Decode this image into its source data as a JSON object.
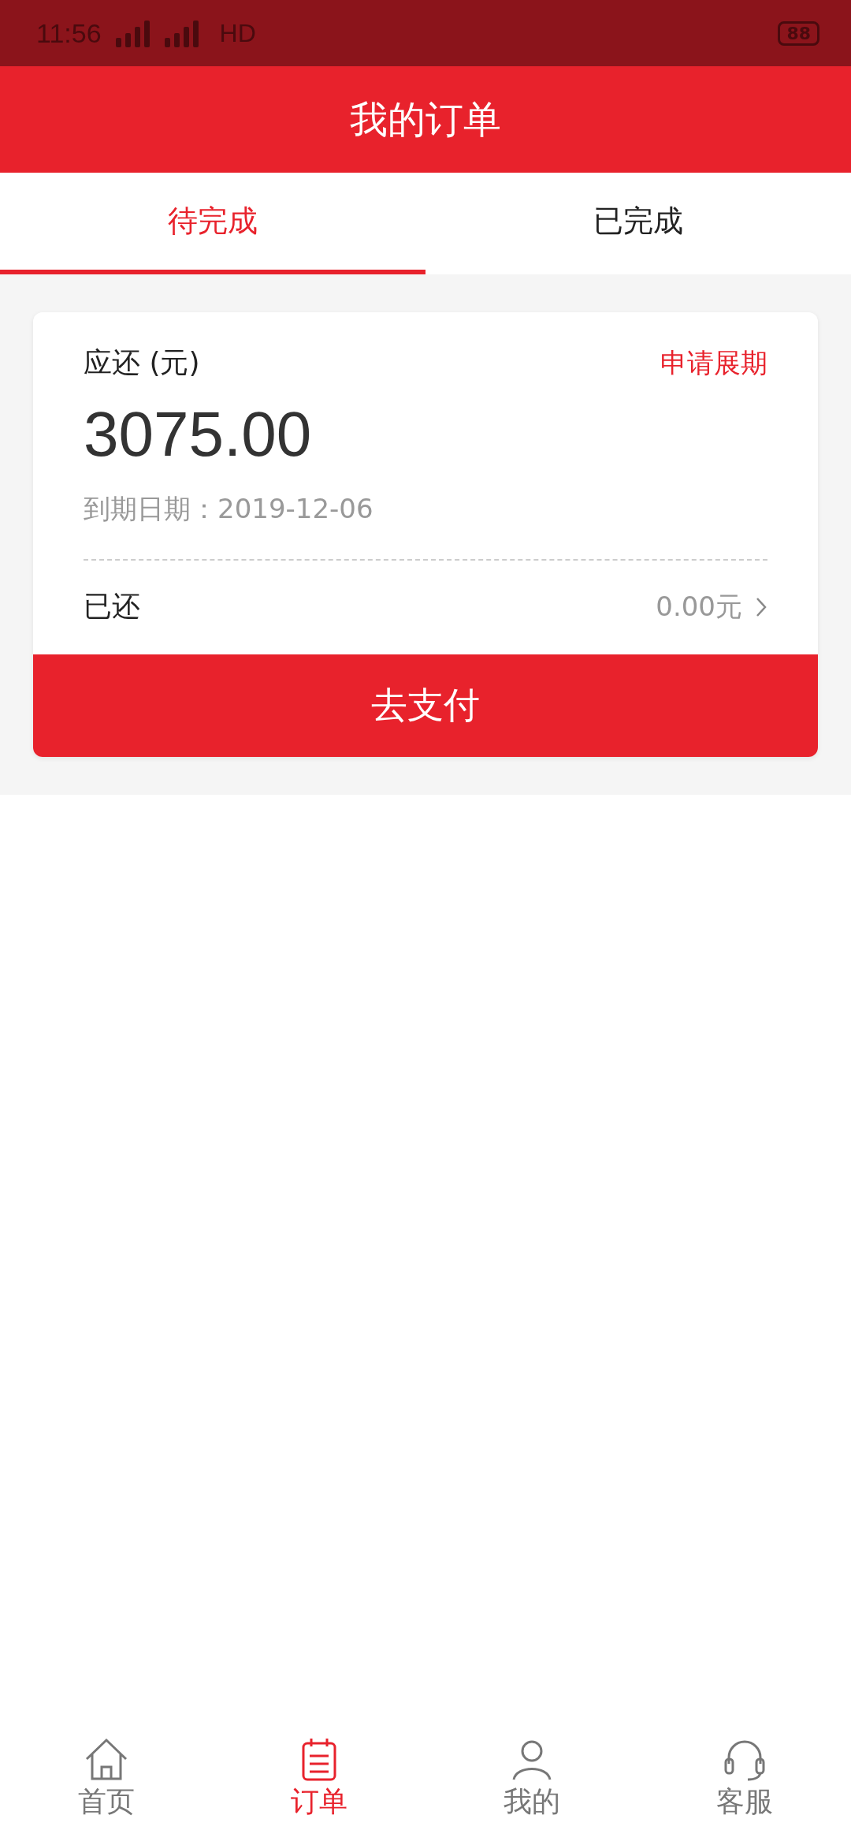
{
  "status_bar": {
    "time": "11:56",
    "network": "HD",
    "battery": "88"
  },
  "header": {
    "title": "我的订单"
  },
  "tabs": [
    {
      "label": "待完成",
      "selected": true
    },
    {
      "label": "已完成",
      "selected": false
    }
  ],
  "order": {
    "amount_label": "应还 (元)",
    "extend_link": "申请展期",
    "amount": "3075.00",
    "due_date": "到期日期：2019-12-06",
    "paid_label": "已还",
    "paid_value": "0.00元",
    "pay_button": "去支付"
  },
  "bottom_nav": [
    {
      "label": "首页",
      "kind": "home",
      "selected": false
    },
    {
      "label": "订单",
      "kind": "orders",
      "selected": true
    },
    {
      "label": "我的",
      "kind": "profile",
      "selected": false
    },
    {
      "label": "客服",
      "kind": "service",
      "selected": false
    }
  ]
}
